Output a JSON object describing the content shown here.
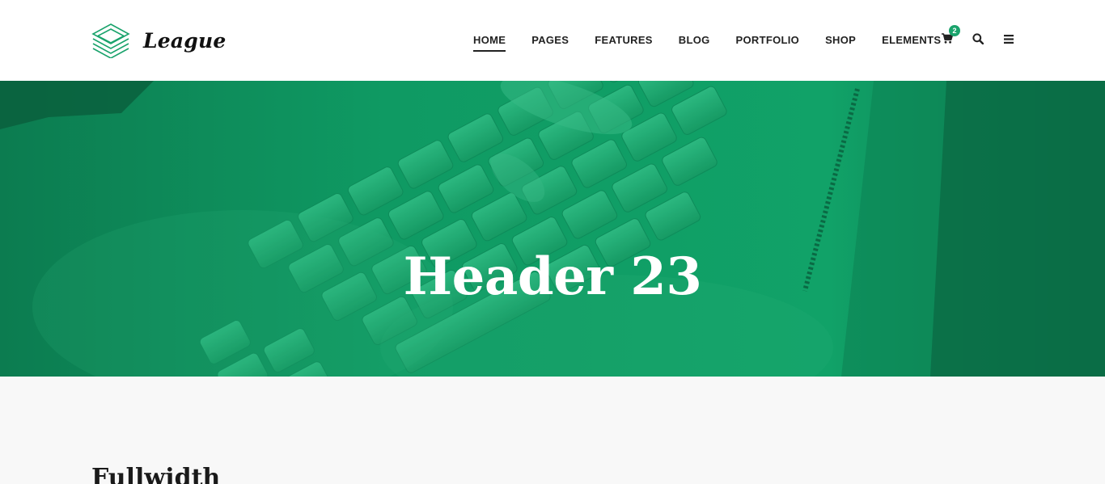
{
  "brand": {
    "name": "League",
    "accent_color": "#1aa36c",
    "logo_icon": "stacked-layers-icon"
  },
  "nav": {
    "items": [
      {
        "label": "HOME",
        "active": true
      },
      {
        "label": "PAGES",
        "active": false
      },
      {
        "label": "FEATURES",
        "active": false
      },
      {
        "label": "BLOG",
        "active": false
      },
      {
        "label": "PORTFOLIO",
        "active": false
      },
      {
        "label": "SHOP",
        "active": false
      },
      {
        "label": "ELEMENTS",
        "active": false
      }
    ],
    "icons": {
      "cart": "cart-icon",
      "search": "search-icon",
      "menu": "hamburger-menu-icon"
    },
    "cart_count": "2"
  },
  "hero": {
    "title": "Header 23",
    "overlay_color": "#0f9a63"
  },
  "content": {
    "heading": "Fullwidth"
  }
}
